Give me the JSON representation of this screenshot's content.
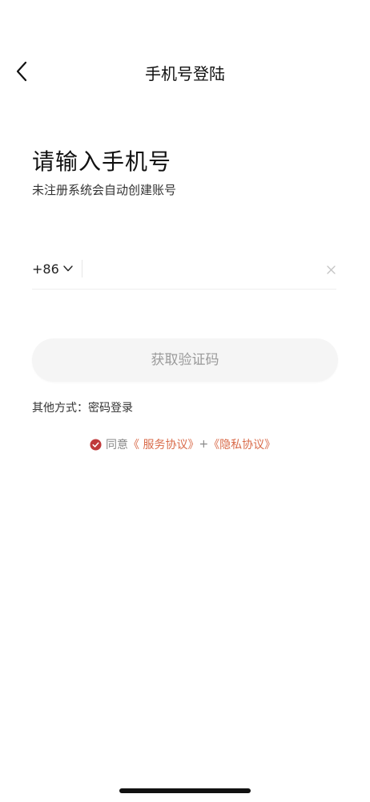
{
  "nav": {
    "title": "手机号登陆"
  },
  "header": {
    "heading": "请输入手机号",
    "subheading": "未注册系统会自动创建账号"
  },
  "phone": {
    "country_code": "+86",
    "value": "",
    "placeholder": ""
  },
  "actions": {
    "get_code_label": "获取验证码",
    "other_prefix": "其他方式：",
    "other_link": "密码登录"
  },
  "agreement": {
    "checked": true,
    "agree_text": "同意",
    "service_link": "《 服务协议》",
    "plus": "+",
    "privacy_link": "《隐私协议》"
  },
  "colors": {
    "accent": "#d96b4a",
    "check": "#c0393b",
    "button_bg": "#f5f5f5",
    "button_text": "#9a9a9a"
  },
  "icons": {
    "back": "chevron-left-icon",
    "country_dropdown": "chevron-down-icon",
    "clear": "close-icon",
    "check": "check-circle-icon"
  }
}
